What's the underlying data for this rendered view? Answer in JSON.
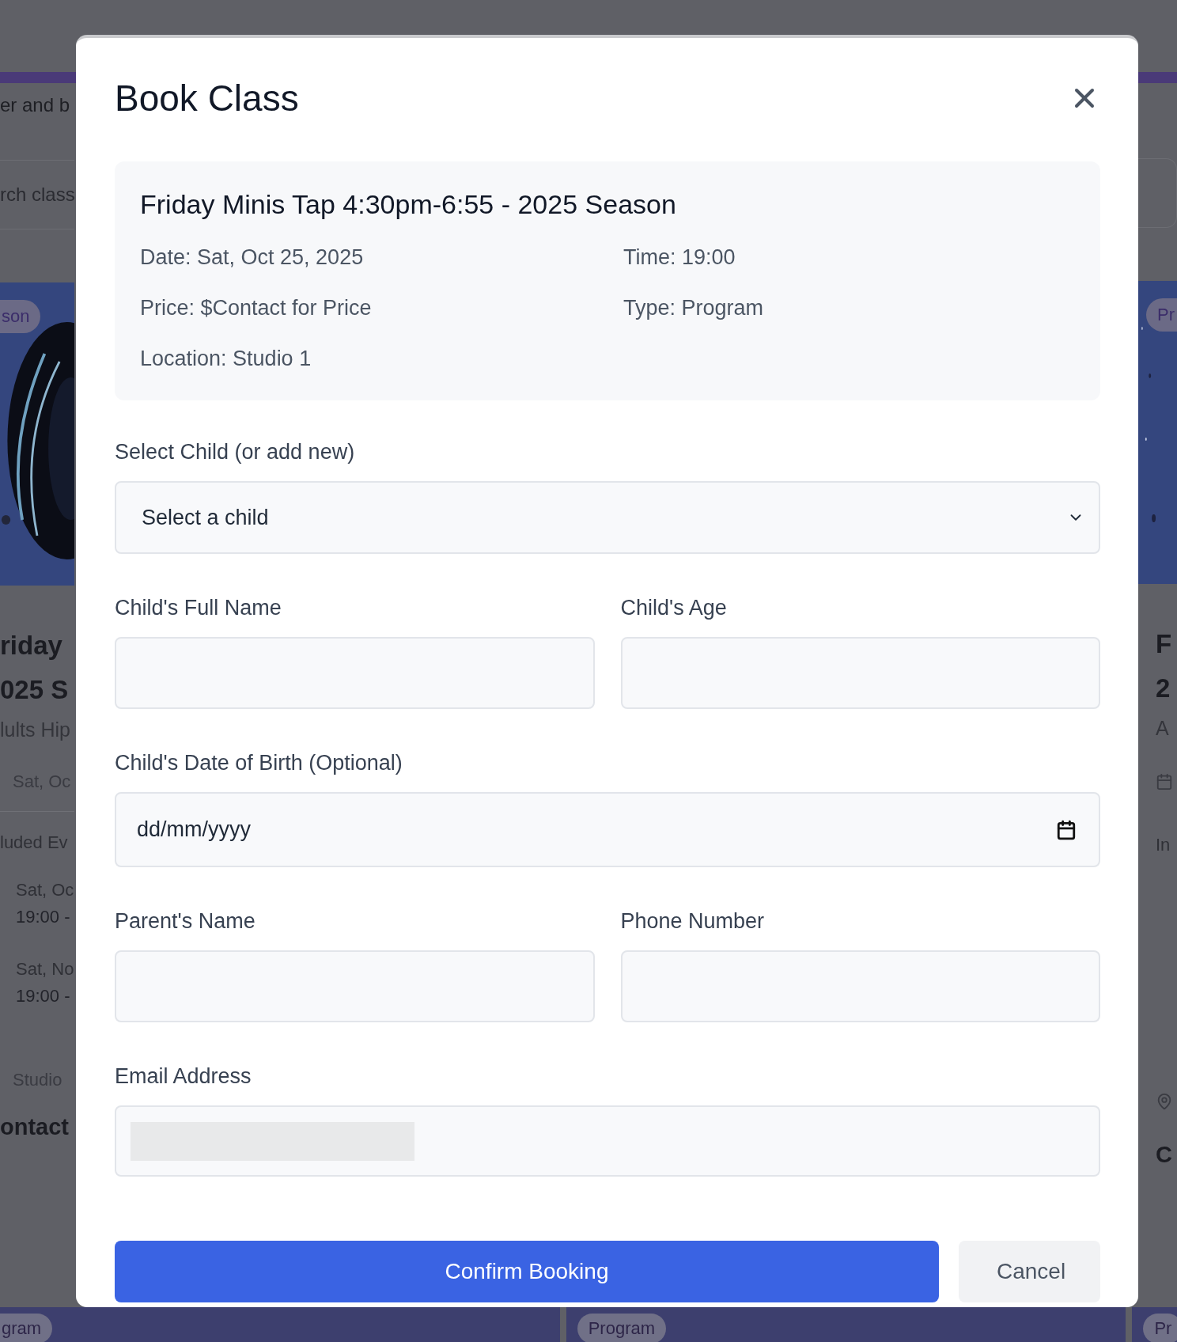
{
  "background_page": {
    "header_text": "er and b",
    "search": {
      "placeholder": "rch class"
    },
    "left_card": {
      "badge": "son",
      "title_lines": [
        "riday",
        "025 S"
      ],
      "subtitle": "lults Hip",
      "date": "Sat, Oc",
      "section": "luded Ev",
      "events": [
        {
          "date": "Sat, Oc",
          "time": "19:00 -"
        },
        {
          "date": "Sat, No",
          "time": "19:00 -"
        }
      ],
      "location": "Studio",
      "contact": "ontact"
    },
    "right_card": {
      "badge": "Pr",
      "title_lines": [
        "F",
        "2"
      ],
      "subtitle": "A",
      "section": "In",
      "contact": "C"
    },
    "bottom_cards": [
      {
        "badge": "gram"
      },
      {
        "badge": "Program"
      },
      {
        "badge": "Pr"
      }
    ]
  },
  "modal": {
    "title": "Book Class",
    "class_info": {
      "title": "Friday Minis Tap 4:30pm-6:55 - 2025 Season",
      "details": [
        "Date: Sat, Oct 25, 2025",
        "Time: 19:00",
        "Price: $Contact for Price",
        "Type: Program",
        "Location: Studio 1"
      ]
    },
    "form_rows": [
      [
        {
          "kind": "select",
          "label": "Select Child (or add new)",
          "value": "Select a child"
        }
      ],
      [
        {
          "kind": "text",
          "label": "Child's Full Name"
        },
        {
          "kind": "text",
          "label": "Child's Age"
        }
      ],
      [
        {
          "kind": "date",
          "label": "Child's Date of Birth (Optional)",
          "placeholder": "dd/mm/yyyy"
        }
      ],
      [
        {
          "kind": "text",
          "label": "Parent's Name"
        },
        {
          "kind": "text",
          "label": "Phone Number"
        }
      ],
      [
        {
          "kind": "email",
          "label": "Email Address",
          "redacted": true
        }
      ]
    ],
    "buttons": [
      {
        "kind": "primary",
        "label": "Confirm Booking"
      },
      {
        "kind": "secondary",
        "label": "Cancel"
      }
    ]
  }
}
